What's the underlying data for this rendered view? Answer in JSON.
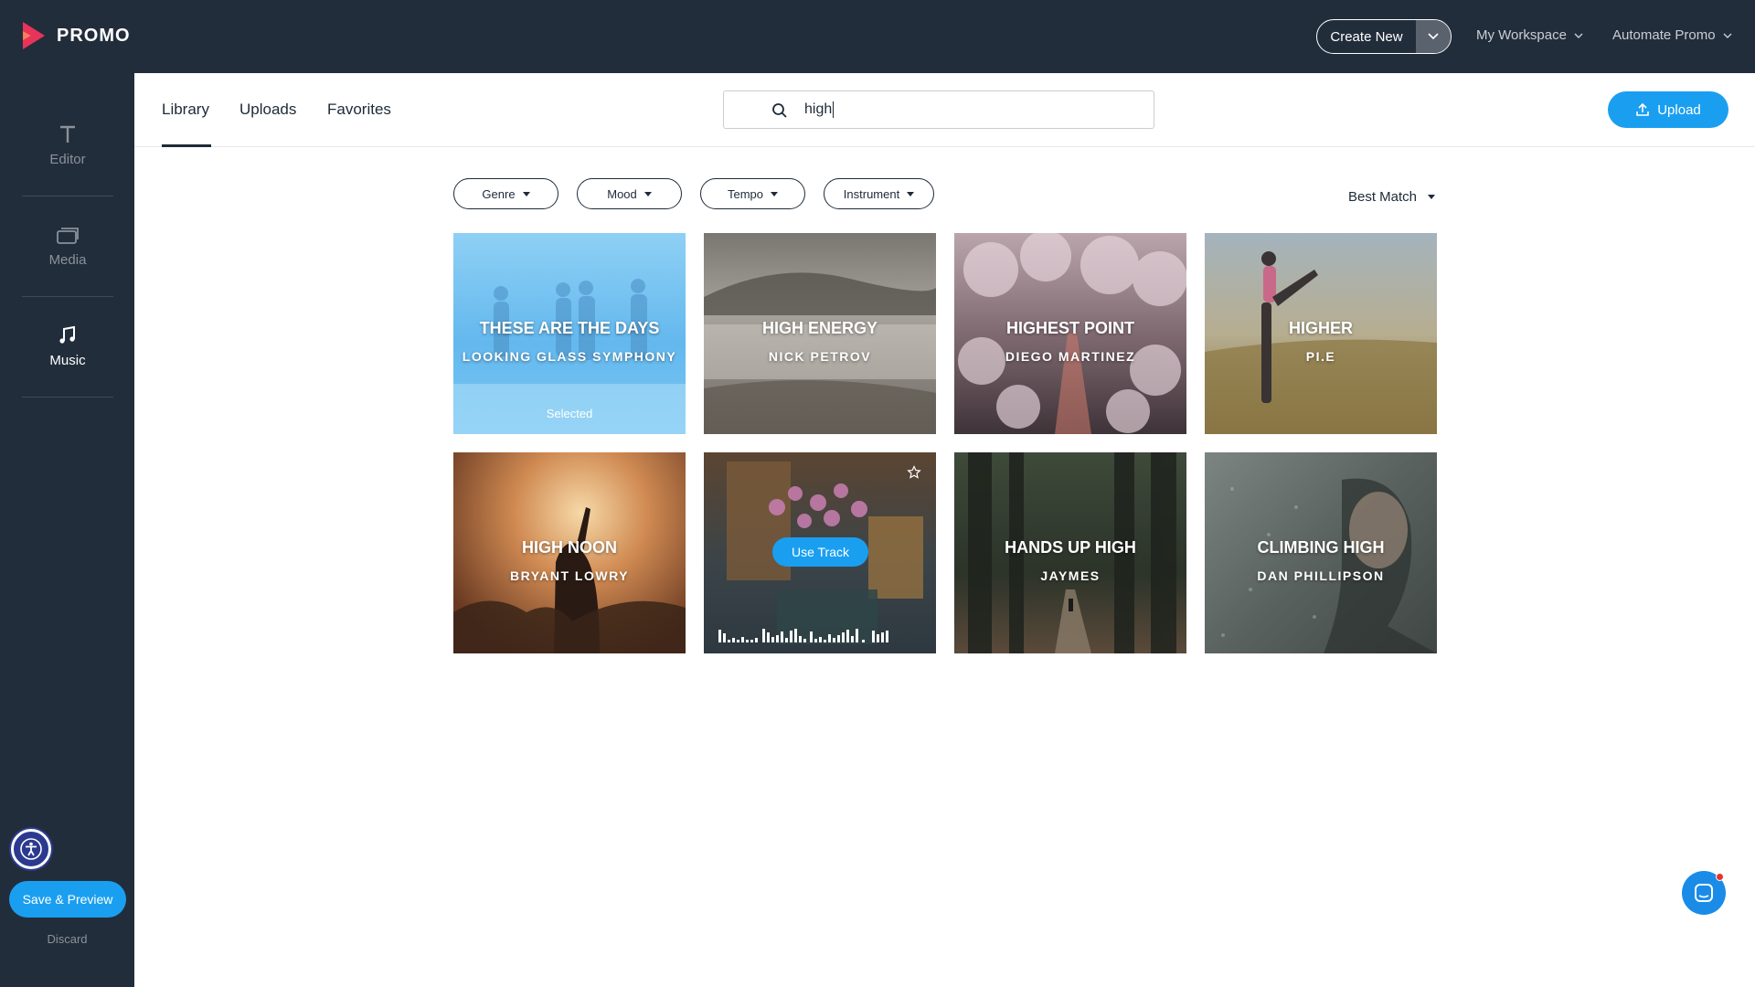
{
  "app": {
    "logo_text": "PROMO"
  },
  "header": {
    "create_new": "Create New",
    "workspace": "My Workspace",
    "automate": "Automate Promo"
  },
  "sidebar": {
    "items": [
      {
        "label": "Editor",
        "icon": "text-icon"
      },
      {
        "label": "Media",
        "icon": "media-icon"
      },
      {
        "label": "Music",
        "icon": "music-icon"
      }
    ],
    "save_preview": "Save & Preview",
    "discard": "Discard"
  },
  "tabs": [
    {
      "label": "Library",
      "active": true
    },
    {
      "label": "Uploads",
      "active": false
    },
    {
      "label": "Favorites",
      "active": false
    }
  ],
  "search": {
    "value": "high"
  },
  "upload_label": "Upload",
  "filters": [
    {
      "label": "Genre"
    },
    {
      "label": "Mood"
    },
    {
      "label": "Tempo"
    },
    {
      "label": "Instrument"
    }
  ],
  "sort_label": "Best Match",
  "tracks": [
    {
      "title": "THESE ARE THE DAYS",
      "artist": "LOOKING GLASS SYMPHONY",
      "status": "Selected"
    },
    {
      "title": "HIGH ENERGY",
      "artist": "NICK PETROV"
    },
    {
      "title": "HIGHEST POINT",
      "artist": "DIEGO MARTINEZ"
    },
    {
      "title": "HIGHER",
      "artist": "PI.E"
    },
    {
      "title": "HIGH NOON",
      "artist": "BRYANT LOWRY"
    },
    {
      "title": "",
      "artist": "",
      "hover_action": "Use Track"
    },
    {
      "title": "HANDS UP HIGH",
      "artist": "JAYMES"
    },
    {
      "title": "CLIMBING HIGH",
      "artist": "DAN PHILLIPSON"
    }
  ],
  "colors": {
    "sidebar_bg": "#222d3b",
    "accent": "#1a9ff0",
    "logo_accent": "#e8335a"
  }
}
